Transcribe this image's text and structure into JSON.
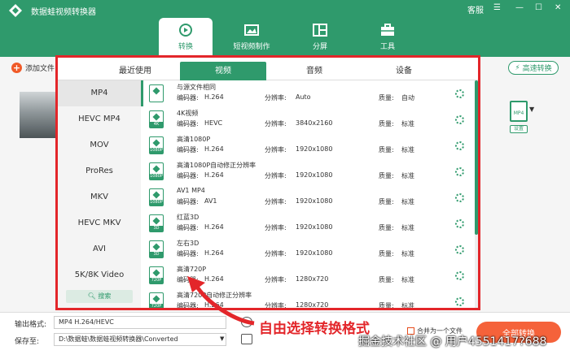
{
  "app": {
    "title": "数据蛙视频转换器"
  },
  "window": {
    "account": "客服"
  },
  "nav": [
    {
      "label": "转换",
      "icon": "convert-icon"
    },
    {
      "label": "短视频制作",
      "icon": "video-edit-icon"
    },
    {
      "label": "分屏",
      "icon": "split-screen-icon"
    },
    {
      "label": "工具",
      "icon": "toolbox-icon"
    }
  ],
  "toolbar": {
    "add_file": "添加文件",
    "speed": "高速转换"
  },
  "right_panel": {
    "format_badge": "MP4",
    "settings": "设置"
  },
  "format_panel": {
    "tabs": [
      "最近使用",
      "视频",
      "音频",
      "设备"
    ],
    "active_tab": 1,
    "categories": [
      "MP4",
      "HEVC MP4",
      "MOV",
      "ProRes",
      "MKV",
      "HEVC MKV",
      "AVI",
      "5K/8K Video"
    ],
    "active_category": 0,
    "search_label": "搜索",
    "codec_label": "编码器:",
    "res_label": "分辨率:",
    "quality_label": "质量:",
    "presets": [
      {
        "name": "与源文件相同",
        "badge": "",
        "codec": "H.264",
        "res": "Auto",
        "quality": "自动"
      },
      {
        "name": "4K视频",
        "badge": "4K",
        "codec": "HEVC",
        "res": "3840x2160",
        "quality": "标准"
      },
      {
        "name": "高清1080P",
        "badge": "1080P",
        "codec": "H.264",
        "res": "1920x1080",
        "quality": "标准"
      },
      {
        "name": "高清1080P自动修正分辨率",
        "badge": "1080P",
        "codec": "H.264",
        "res": "1920x1080",
        "quality": "标准"
      },
      {
        "name": "AV1 MP4",
        "badge": "1080P",
        "codec": "AV1",
        "res": "1920x1080",
        "quality": "标准"
      },
      {
        "name": "红蓝3D",
        "badge": "3D",
        "codec": "H.264",
        "res": "1920x1080",
        "quality": "标准"
      },
      {
        "name": "左右3D",
        "badge": "3D",
        "codec": "H.264",
        "res": "1920x1080",
        "quality": "标准"
      },
      {
        "name": "高清720P",
        "badge": "720P",
        "codec": "H.264",
        "res": "1280x720",
        "quality": "标准"
      },
      {
        "name": "高清720P自动修正分辨率",
        "badge": "720P",
        "codec": "H.264",
        "res": "1280x720",
        "quality": "标准"
      }
    ]
  },
  "bottom": {
    "output_label": "输出格式:",
    "output_value": "MP4 H.264/HEVC",
    "save_label": "保存至:",
    "save_path": "D:\\数据蛙\\数据蛙视频转换器\\Converted",
    "merge_label": "合并为一个文件",
    "convert_all": "全部转换"
  },
  "annotation": "自由选择转换格式",
  "watermark": "掘金技术社区 @ 用户4551417?688",
  "colors": {
    "brand": "#2f9a6c",
    "accent": "#f5623a",
    "highlight": "#e3262a"
  }
}
